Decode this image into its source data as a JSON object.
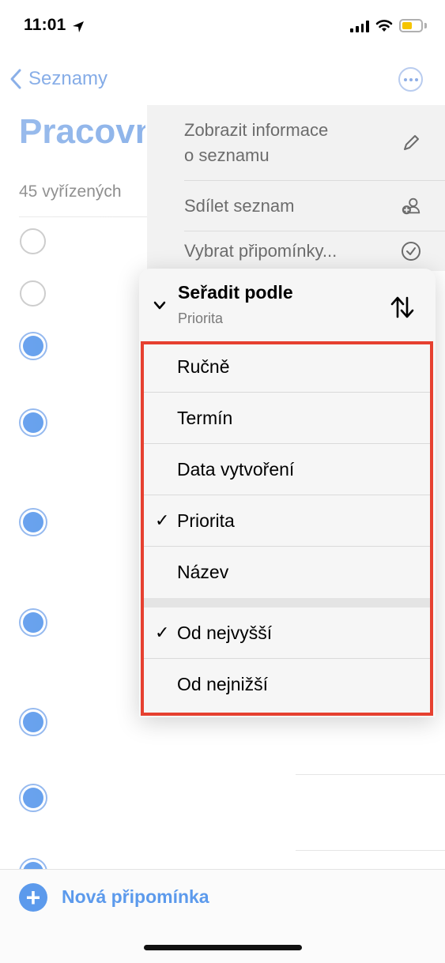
{
  "status_bar": {
    "time": "11:01",
    "battery_level": 0.45,
    "battery_color": "#f5c400"
  },
  "nav": {
    "back_label": "Seznamy"
  },
  "list": {
    "title": "Pracovní",
    "completed_count": "45 vyřízených"
  },
  "reminders": [
    {
      "completed": false
    },
    {
      "completed": false
    },
    {
      "completed": true
    },
    {
      "completed": true
    },
    {
      "completed": true
    },
    {
      "completed": true
    },
    {
      "completed": true
    },
    {
      "completed": true
    }
  ],
  "menu": {
    "items": [
      {
        "label_line1": "Zobrazit informace",
        "label_line2": "o seznamu",
        "icon": "pencil-icon"
      },
      {
        "label": "Sdílet seznam",
        "icon": "share-person-icon"
      },
      {
        "label": "Vybrat připomínky...",
        "icon": "checkmark-circle-icon"
      }
    ],
    "sort": {
      "title": "Seřadit podle",
      "current": "Priorita",
      "options": [
        {
          "label": "Ručně",
          "checked": false
        },
        {
          "label": "Termín",
          "checked": false
        },
        {
          "label": "Data vytvoření",
          "checked": false
        },
        {
          "label": "Priorita",
          "checked": true
        },
        {
          "label": "Název",
          "checked": false
        }
      ],
      "order_options": [
        {
          "label": "Od nejvyšší",
          "checked": true
        },
        {
          "label": "Od nejnižší",
          "checked": false
        }
      ],
      "highlight_color": "#e64030"
    }
  },
  "bottom": {
    "add_label": "Nová připomínka"
  },
  "colors": {
    "accent": "#5c9aec",
    "highlight": "#e64030"
  }
}
